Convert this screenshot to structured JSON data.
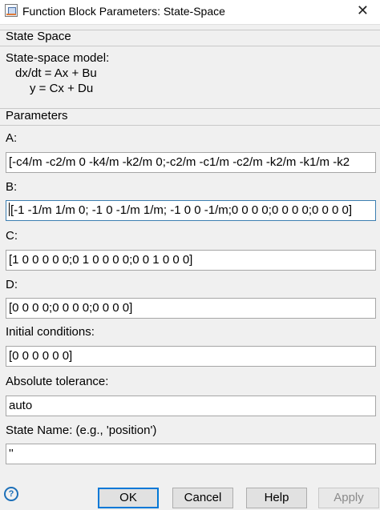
{
  "window": {
    "title": "Function Block Parameters: State-Space",
    "close_glyph": "✕"
  },
  "block": {
    "name": "State Space",
    "description_title": "State-space model:",
    "equation_1": "dx/dt = Ax + Bu",
    "equation_2": "y = Cx + Du"
  },
  "parameters": {
    "section_label": "Parameters",
    "a_label": "A:",
    "a_value": "[-c4/m -c2/m 0 -k4/m -k2/m 0;-c2/m -c1/m -c2/m -k2/m -k1/m -k2",
    "b_label": "B:",
    "b_value": "[-1 -1/m 1/m 0; -1 0 -1/m 1/m; -1 0 0 -1/m;0 0 0 0;0 0 0 0;0 0 0 0]",
    "c_label": "C:",
    "c_value": "[1 0 0 0 0 0;0 1 0 0 0 0;0 0 1 0 0 0]",
    "d_label": "D:",
    "d_value": "[0 0 0 0;0 0 0 0;0 0 0 0]",
    "ic_label": "Initial conditions:",
    "ic_value": "[0 0 0 0 0 0]",
    "tol_label": "Absolute tolerance:",
    "tol_value": "auto",
    "statename_label": "State Name: (e.g., 'position')",
    "statename_value": "''"
  },
  "footer": {
    "help_icon": "question-circle-icon",
    "ok_label": "OK",
    "cancel_label": "Cancel",
    "help_label": "Help",
    "apply_label": "Apply"
  },
  "colors": {
    "focus_border": "#3c7fb1",
    "default_button_border": "#0078d7",
    "help_icon": "#1c6fb8"
  }
}
